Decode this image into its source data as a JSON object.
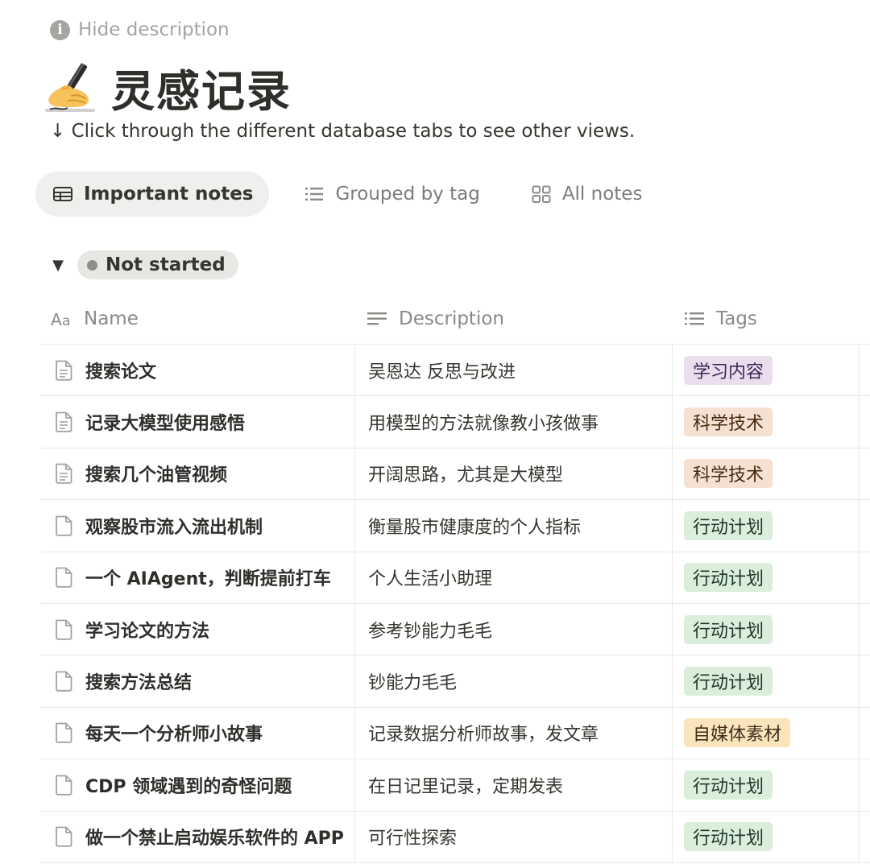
{
  "hide_description": {
    "label": "Hide description",
    "icon": "info-icon"
  },
  "page": {
    "emoji": "writing-hand-icon",
    "title": "灵感记录",
    "subtitle": "↓ Click through the different database tabs to see other views."
  },
  "tabs": [
    {
      "label": "Important notes",
      "icon": "table-icon",
      "active": true
    },
    {
      "label": "Grouped by tag",
      "icon": "list-icon",
      "active": false
    },
    {
      "label": "All notes",
      "icon": "gallery-icon",
      "active": false
    }
  ],
  "group": {
    "label": "Not started",
    "dot_color": "#8f8e8a"
  },
  "columns": [
    {
      "label": "Name",
      "icon": "text-aa-icon"
    },
    {
      "label": "Description",
      "icon": "text-lines-icon"
    },
    {
      "label": "Tags",
      "icon": "multi-select-icon"
    }
  ],
  "tag_colors": {
    "学习内容": "purple",
    "科学技术": "orange",
    "行动计划": "green",
    "自媒体素材": "yellow"
  },
  "rows": [
    {
      "name": "搜索论文",
      "description": "吴恩达 反思与改进",
      "tag": "学习内容",
      "has_content": true
    },
    {
      "name": "记录大模型使用感悟",
      "description": "用模型的方法就像教小孩做事",
      "tag": "科学技术",
      "has_content": true
    },
    {
      "name": "搜索几个油管视频",
      "description": "开阔思路，尤其是大模型",
      "tag": "科学技术",
      "has_content": true
    },
    {
      "name": "观察股市流入流出机制",
      "description": "衡量股市健康度的个人指标",
      "tag": "行动计划",
      "has_content": false
    },
    {
      "name": "一个 AIAgent，判断提前打车",
      "description": "个人生活小助理",
      "tag": "行动计划",
      "has_content": false
    },
    {
      "name": "学习论文的方法",
      "description": "参考钞能力毛毛",
      "tag": "行动计划",
      "has_content": false
    },
    {
      "name": "搜索方法总结",
      "description": "钞能力毛毛",
      "tag": "行动计划",
      "has_content": false
    },
    {
      "name": "每天一个分析师小故事",
      "description": "记录数据分析师故事，发文章",
      "tag": "自媒体素材",
      "has_content": false
    },
    {
      "name": "CDP 领域遇到的奇怪问题",
      "description": "在日记里记录，定期发表",
      "tag": "行动计划",
      "has_content": false
    },
    {
      "name": "做一个禁止启动娱乐软件的 APP",
      "description": "可行性探索",
      "tag": "行动计划",
      "has_content": false
    }
  ]
}
